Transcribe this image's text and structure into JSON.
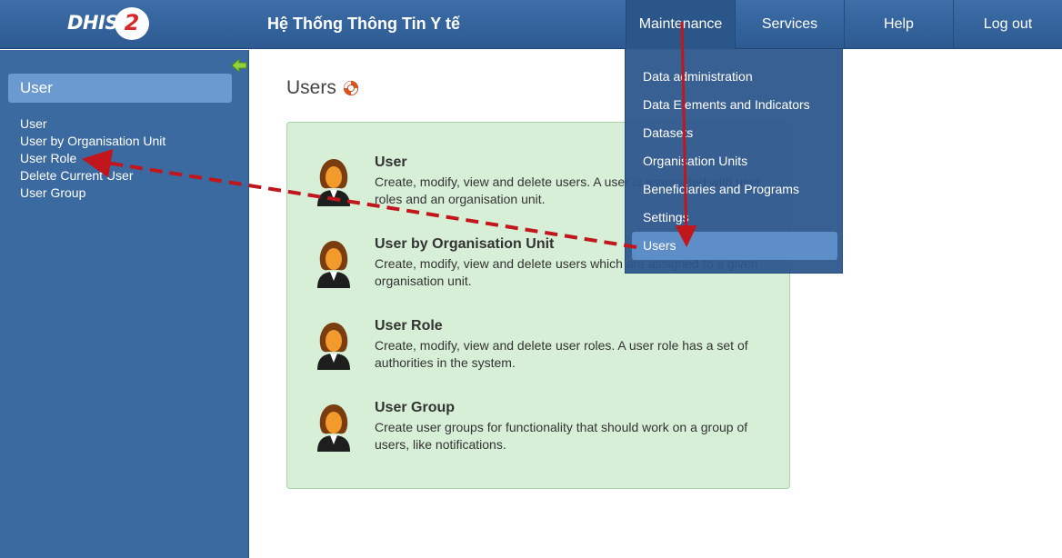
{
  "header": {
    "logo_text": "DHIS",
    "logo_badge": "2",
    "app_title": "Hệ Thống Thông Tin Y tế",
    "menu": [
      {
        "label": "Maintenance"
      },
      {
        "label": "Services"
      },
      {
        "label": "Help"
      },
      {
        "label": "Log out"
      }
    ]
  },
  "sidebar": {
    "heading": "User",
    "links": [
      {
        "label": "User"
      },
      {
        "label": "User by Organisation Unit"
      },
      {
        "label": "User Role"
      },
      {
        "label": "Delete Current User"
      },
      {
        "label": "User Group"
      }
    ]
  },
  "main": {
    "title": "Users",
    "items": [
      {
        "title": "User",
        "description": "Create, modify, view and delete users. A user is associated with user roles and an organisation unit."
      },
      {
        "title": "User by Organisation Unit",
        "description": "Create, modify, view and delete users which are assigned to a given organisation unit."
      },
      {
        "title": "User Role",
        "description": "Create, modify, view and delete user roles. A user role has a set of authorities in the system."
      },
      {
        "title": "User Group",
        "description": "Create user groups for functionality that should work on a group of users, like notifications."
      }
    ]
  },
  "dropdown": {
    "items": [
      {
        "label": "Data administration"
      },
      {
        "label": "Data Elements and Indicators"
      },
      {
        "label": "Datasets"
      },
      {
        "label": "Organisation Units"
      },
      {
        "label": "Beneficiaries and Programs"
      },
      {
        "label": "Settings"
      },
      {
        "label": "Users"
      }
    ],
    "selected": "Users"
  },
  "colors": {
    "header_bg": "#2d5a91",
    "sidebar_bg": "#3a6aa0",
    "panel_bg": "#d7efd7",
    "annotation_arrow": "#c0161c"
  }
}
